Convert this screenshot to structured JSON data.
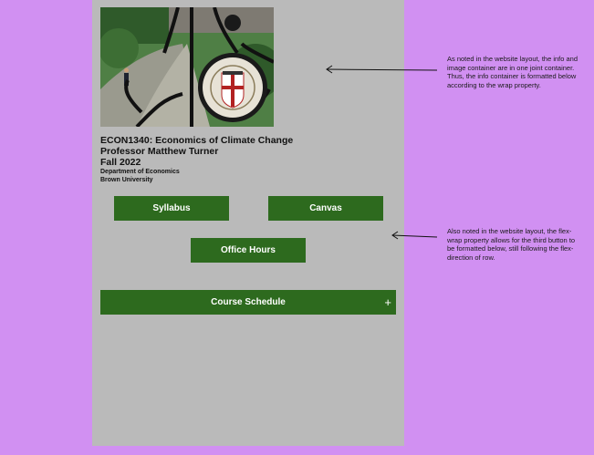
{
  "course": {
    "code_title": "ECON1340: Economics of Climate Change",
    "professor": "Professor Matthew Turner",
    "term": "Fall 2022",
    "department": "Department of Economics",
    "university": "Brown University"
  },
  "buttons": {
    "syllabus": "Syllabus",
    "canvas": "Canvas",
    "office_hours": "Office Hours",
    "schedule": "Course Schedule",
    "schedule_toggle": "+"
  },
  "annotations": {
    "note_1": "As noted in the website layout, the info and image container are in one joint container. Thus, the info container is formatted below according to the wrap property.",
    "note_2": "Also noted in the website layout, the flex-wrap property allows for the third button to be formatted below, still following the flex-direction of row."
  },
  "colors": {
    "canvas_bg": "#d190f2",
    "panel_bg": "#bababa",
    "button_bg": "#2d6a1e",
    "button_text": "#ffffff"
  }
}
